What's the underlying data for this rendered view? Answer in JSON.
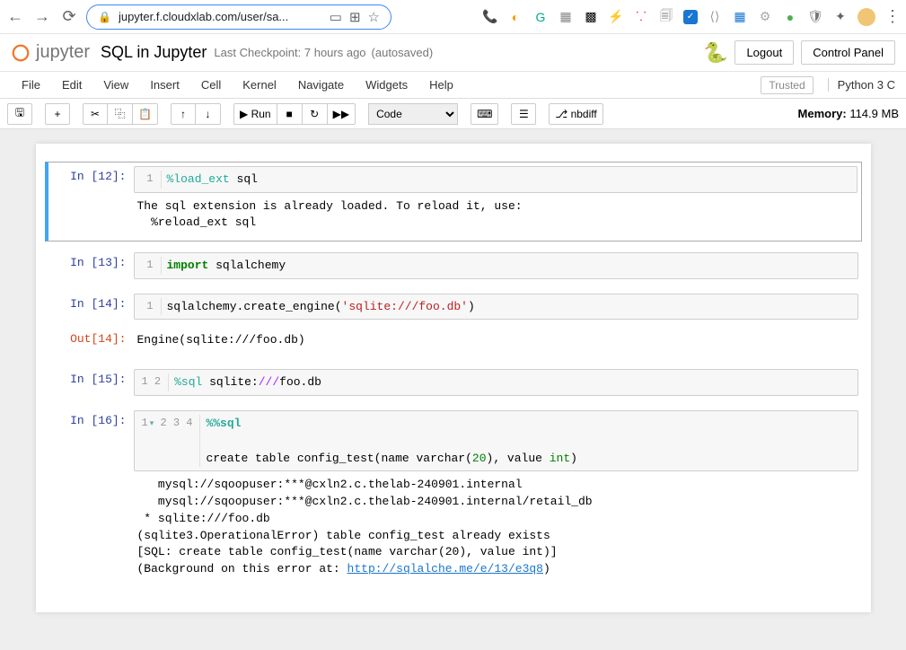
{
  "browser": {
    "url": "jupyter.f.cloudxlab.com/user/sa..."
  },
  "header": {
    "logo_text": "jupyter",
    "title": "SQL in Jupyter",
    "checkpoint": "Last Checkpoint: 7 hours ago",
    "autosaved": "(autosaved)",
    "logout": "Logout",
    "control_panel": "Control Panel"
  },
  "menubar": {
    "items": [
      "File",
      "Edit",
      "View",
      "Insert",
      "Cell",
      "Kernel",
      "Navigate",
      "Widgets",
      "Help"
    ],
    "trusted": "Trusted",
    "kernel": "Python 3  C"
  },
  "toolbar": {
    "run": "Run",
    "celltype": "Code",
    "nbdiff": "nbdiff",
    "memory_label": "Memory: ",
    "memory_value": "114.9 MB"
  },
  "cells": {
    "c12": {
      "prompt": "In [12]:",
      "gutter": "1",
      "code_magic": "%load_ext",
      "code_rest": " sql",
      "output": "The sql extension is already loaded. To reload it, use:\n  %reload_ext sql"
    },
    "c13": {
      "prompt": "In [13]:",
      "gutter": "1",
      "kw": "import",
      "rest": " sqlalchemy"
    },
    "c14": {
      "prompt": "In [14]:",
      "gutter": "1",
      "pre": "sqlalchemy.create_engine(",
      "str": "'sqlite:///foo.db'",
      "post": ")",
      "out_prompt": "Out[14]:",
      "out": "Engine(sqlite:///foo.db)"
    },
    "c15": {
      "prompt": "In [15]:",
      "gutter": "1\n2",
      "magic": "%sql",
      "mid": " sqlite:",
      "op": "///",
      "rest": "foo.db"
    },
    "c16": {
      "prompt": "In [16]:",
      "gutter1": "1",
      "gutter_arrow": "▾",
      "gutter_rest": "2\n3\n4",
      "magic": "%%sql",
      "line3_pre": "create table config_test(name varchar(",
      "line3_num": "20",
      "line3_mid": "), value ",
      "line3_int": "int",
      "line3_post": ")",
      "out": "   mysql://sqoopuser:***@cxln2.c.thelab-240901.internal\n   mysql://sqoopuser:***@cxln2.c.thelab-240901.internal/retail_db\n * sqlite:///foo.db\n(sqlite3.OperationalError) table config_test already exists\n[SQL: create table config_test(name varchar(20), value int)]\n(Background on this error at: ",
      "out_link": "http://sqlalche.me/e/13/e3q8",
      "out_post": ")"
    }
  }
}
